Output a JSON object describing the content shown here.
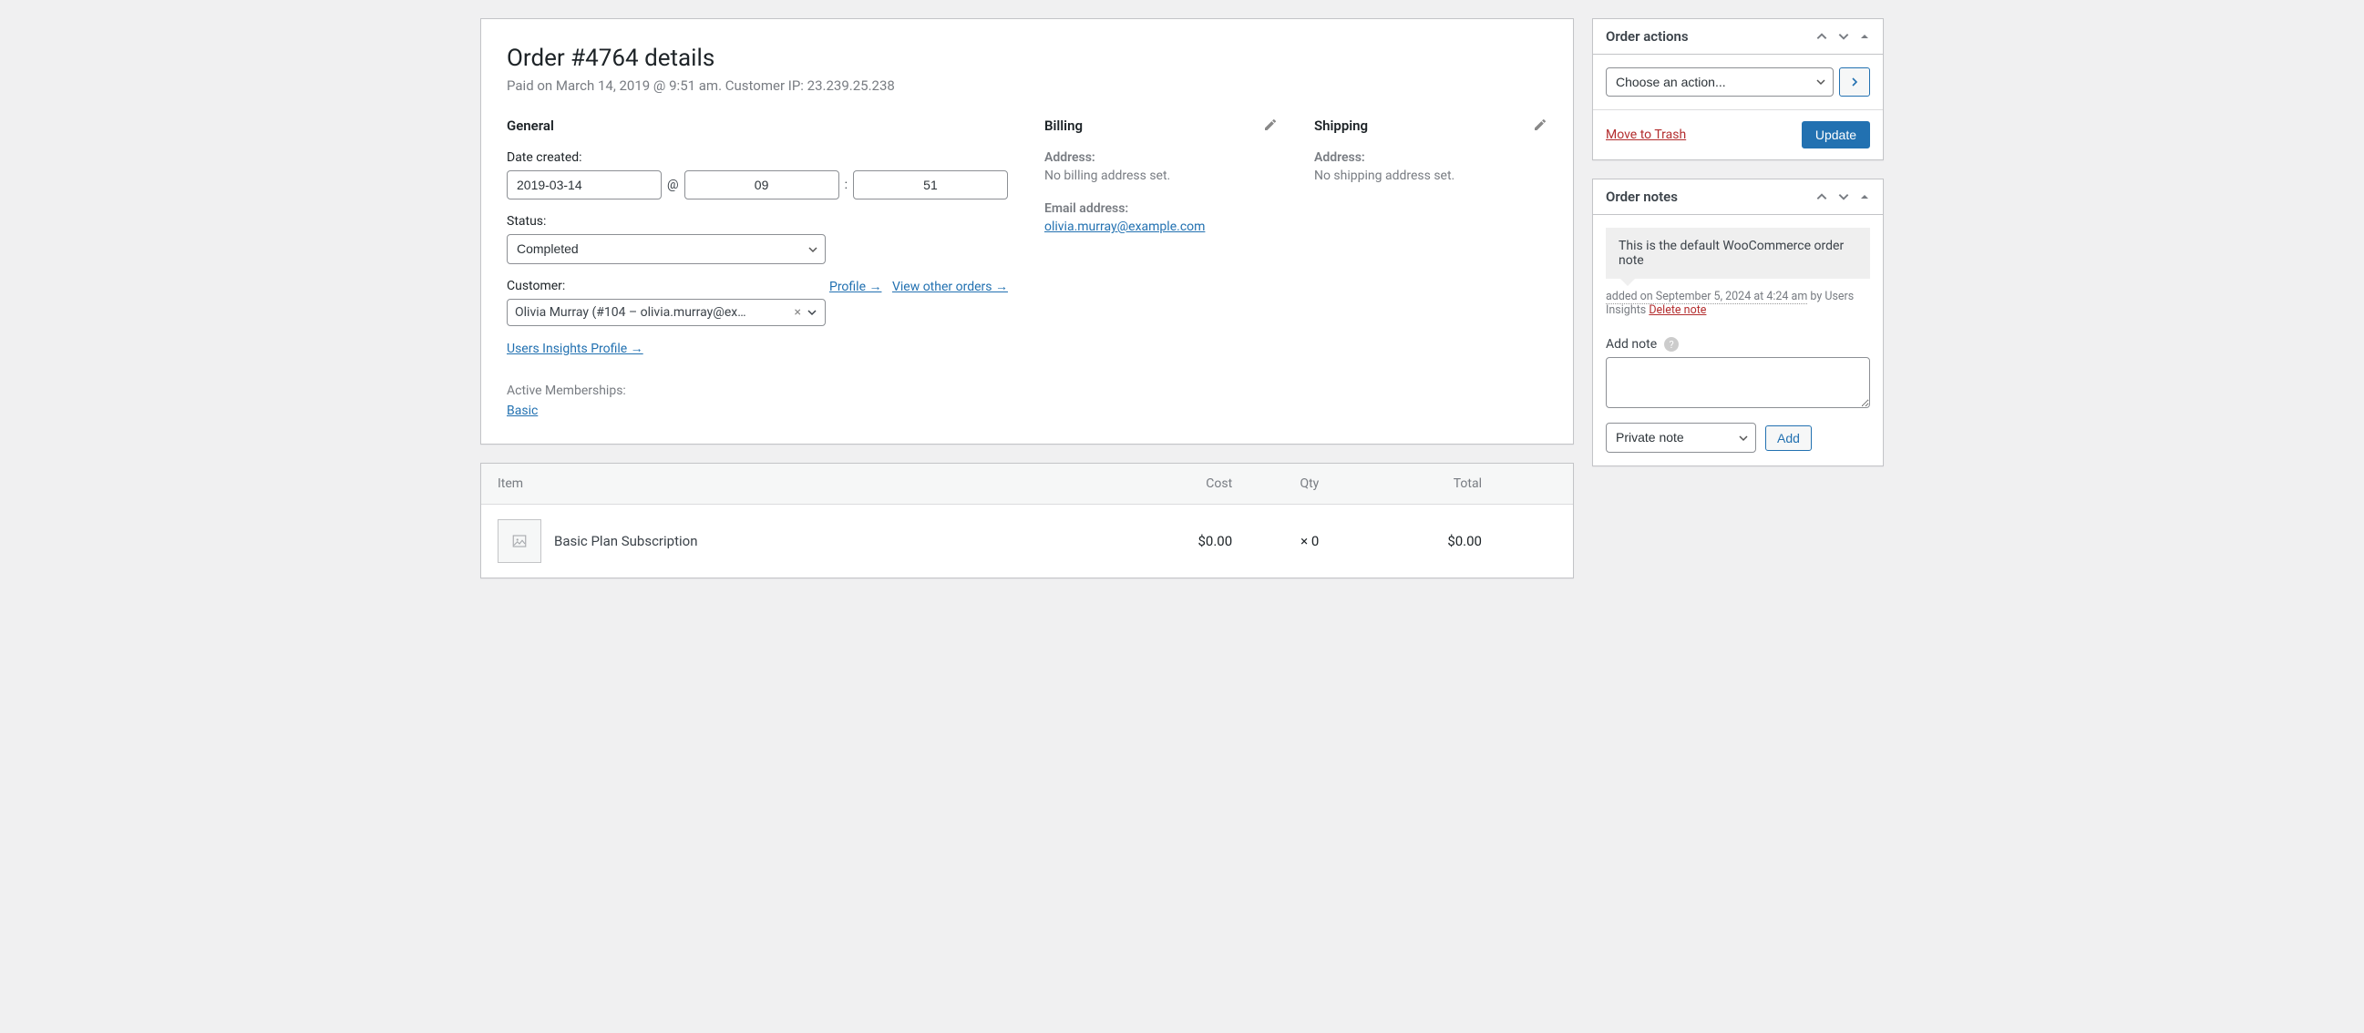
{
  "order": {
    "title": "Order #4764 details",
    "meta": "Paid on March 14, 2019 @ 9:51 am. Customer IP: 23.239.25.238"
  },
  "general": {
    "heading": "General",
    "date_created_label": "Date created:",
    "date": "2019-03-14",
    "at": "@",
    "hour": "09",
    "sep": ":",
    "min": "51",
    "status_label": "Status:",
    "status": "Completed",
    "customer_label": "Customer:",
    "profile_link": "Profile →",
    "view_other_link": "View other orders →",
    "customer_value": "Olivia Murray (#104 – olivia.murray@ex…",
    "ui_profile_link": "Users Insights Profile →",
    "memberships_label": "Active Memberships:",
    "membership_link": "Basic"
  },
  "billing": {
    "heading": "Billing",
    "address_label": "Address:",
    "address_empty": "No billing address set.",
    "email_label": "Email address:",
    "email": "olivia.murray@example.com"
  },
  "shipping": {
    "heading": "Shipping",
    "address_label": "Address:",
    "address_empty": "No shipping address set."
  },
  "items_table": {
    "h_item": "Item",
    "h_cost": "Cost",
    "h_qty": "Qty",
    "h_total": "Total",
    "rows": [
      {
        "name": "Basic Plan Subscription",
        "cost": "$0.00",
        "qty": "×  0",
        "total": "$0.00"
      }
    ]
  },
  "order_actions": {
    "title": "Order actions",
    "placeholder": "Choose an action...",
    "trash": "Move to Trash",
    "update": "Update"
  },
  "order_notes": {
    "title": "Order notes",
    "note_text": "This is the default WooCommerce order note",
    "added_date": "added on September 5, 2024 at 4:24 am",
    "by": " by Users Insights ",
    "delete": "Delete note",
    "add_label": "Add note",
    "type": "Private note",
    "add_btn": "Add"
  },
  "chart_data": {
    "type": "table",
    "title": "Order line items",
    "columns": [
      "Item",
      "Cost",
      "Qty",
      "Total"
    ],
    "rows": [
      [
        "Basic Plan Subscription",
        0.0,
        0,
        0.0
      ]
    ],
    "currency": "USD"
  }
}
